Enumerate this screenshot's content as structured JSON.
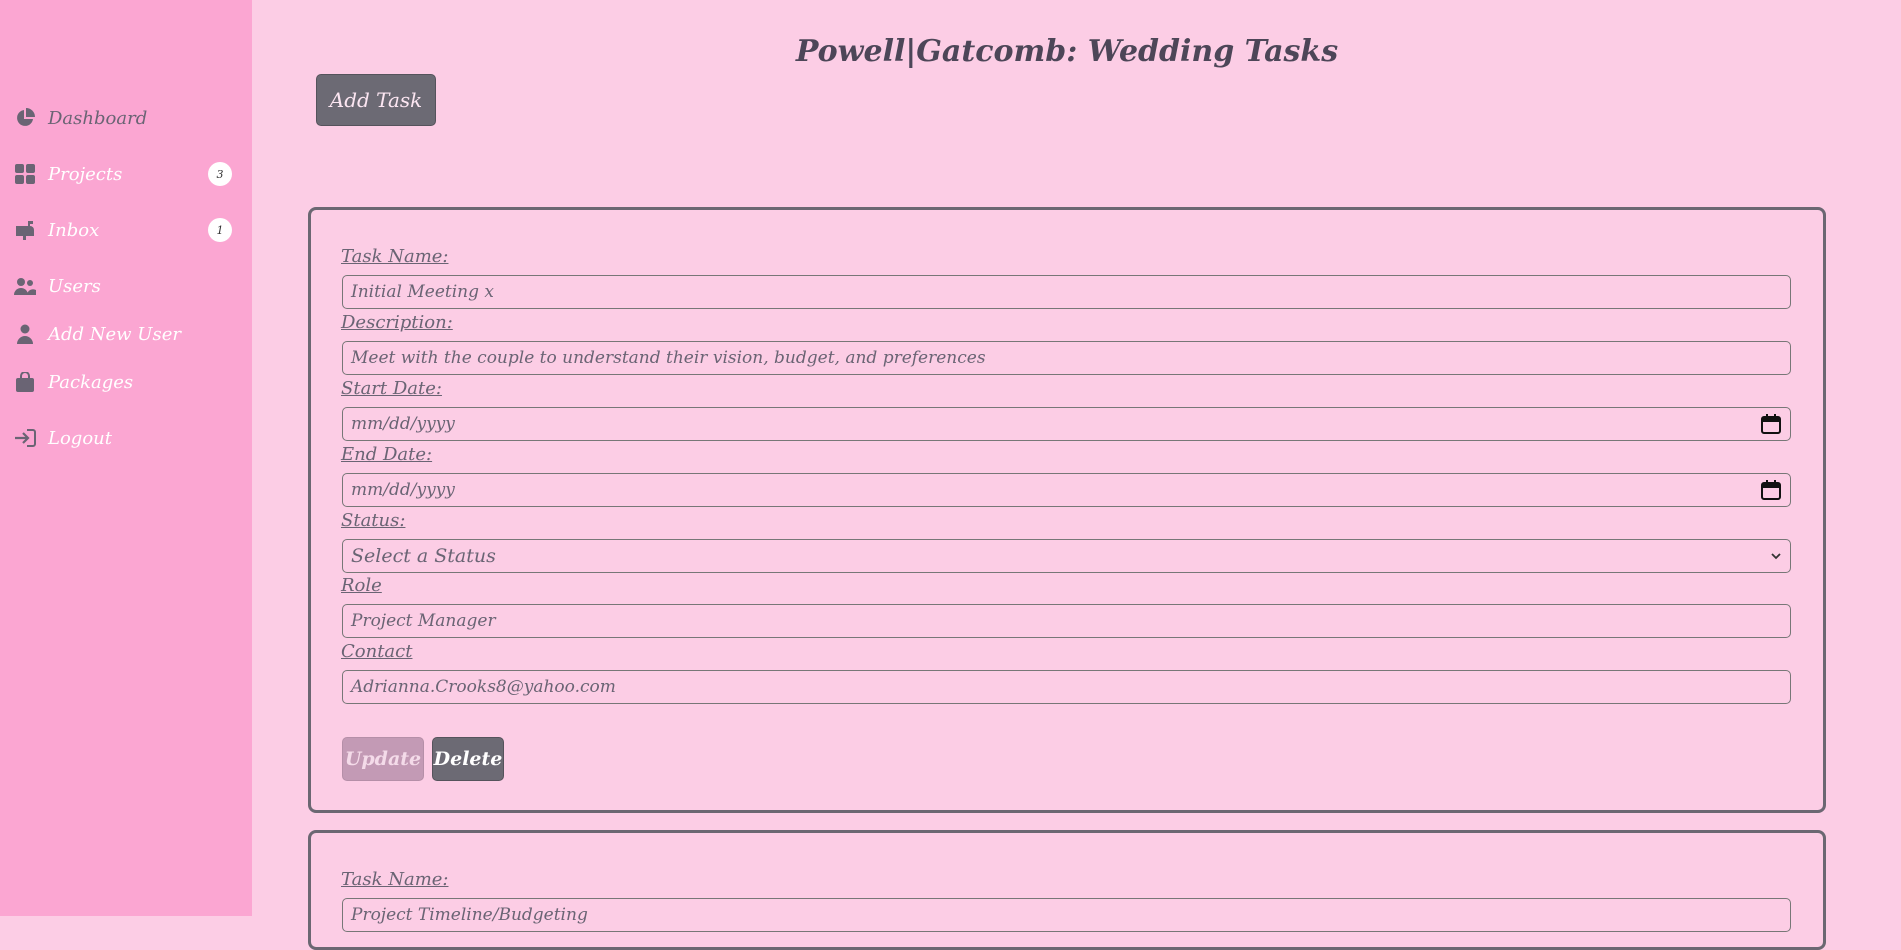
{
  "sidebar": {
    "items": [
      {
        "label": "Dashboard",
        "icon": "pie-chart-icon"
      },
      {
        "label": "Projects",
        "icon": "grid-icon",
        "badge": "3"
      },
      {
        "label": "Inbox",
        "icon": "mailbox-icon",
        "badge": "1"
      },
      {
        "label": "Users",
        "icon": "users-icon"
      },
      {
        "label": "Add New User",
        "icon": "user-icon"
      },
      {
        "label": "Packages",
        "icon": "bag-icon"
      },
      {
        "label": "Logout",
        "icon": "logout-icon"
      }
    ]
  },
  "header": {
    "title": "Powell|Gatcomb: Wedding Tasks",
    "add_task_label": "Add Task"
  },
  "tasks": [
    {
      "task_name_label": "Task Name:",
      "task_name": "Initial Meeting x",
      "description_label": "Description:",
      "description": "Meet with the couple to understand their vision, budget, and preferences",
      "start_date_label": "Start Date:",
      "start_date_placeholder": "mm/dd/yyyy",
      "end_date_label": "End Date:",
      "end_date_placeholder": "mm/dd/yyyy",
      "status_label": "Status:",
      "status_value": "Select a Status",
      "role_label": "Role",
      "role": "Project Manager",
      "contact_label": "Contact",
      "contact": "Adrianna.Crooks8@yahoo.com",
      "update_label": "Update",
      "delete_label": "Delete"
    },
    {
      "task_name_label": "Task Name:",
      "task_name": "Project Timeline/Budgeting"
    }
  ],
  "colors": {
    "sidebar_bg": "#fba6d2",
    "page_bg": "#fccde5",
    "button_dark": "#6c6a74",
    "button_disabled": "#c39ab5"
  }
}
